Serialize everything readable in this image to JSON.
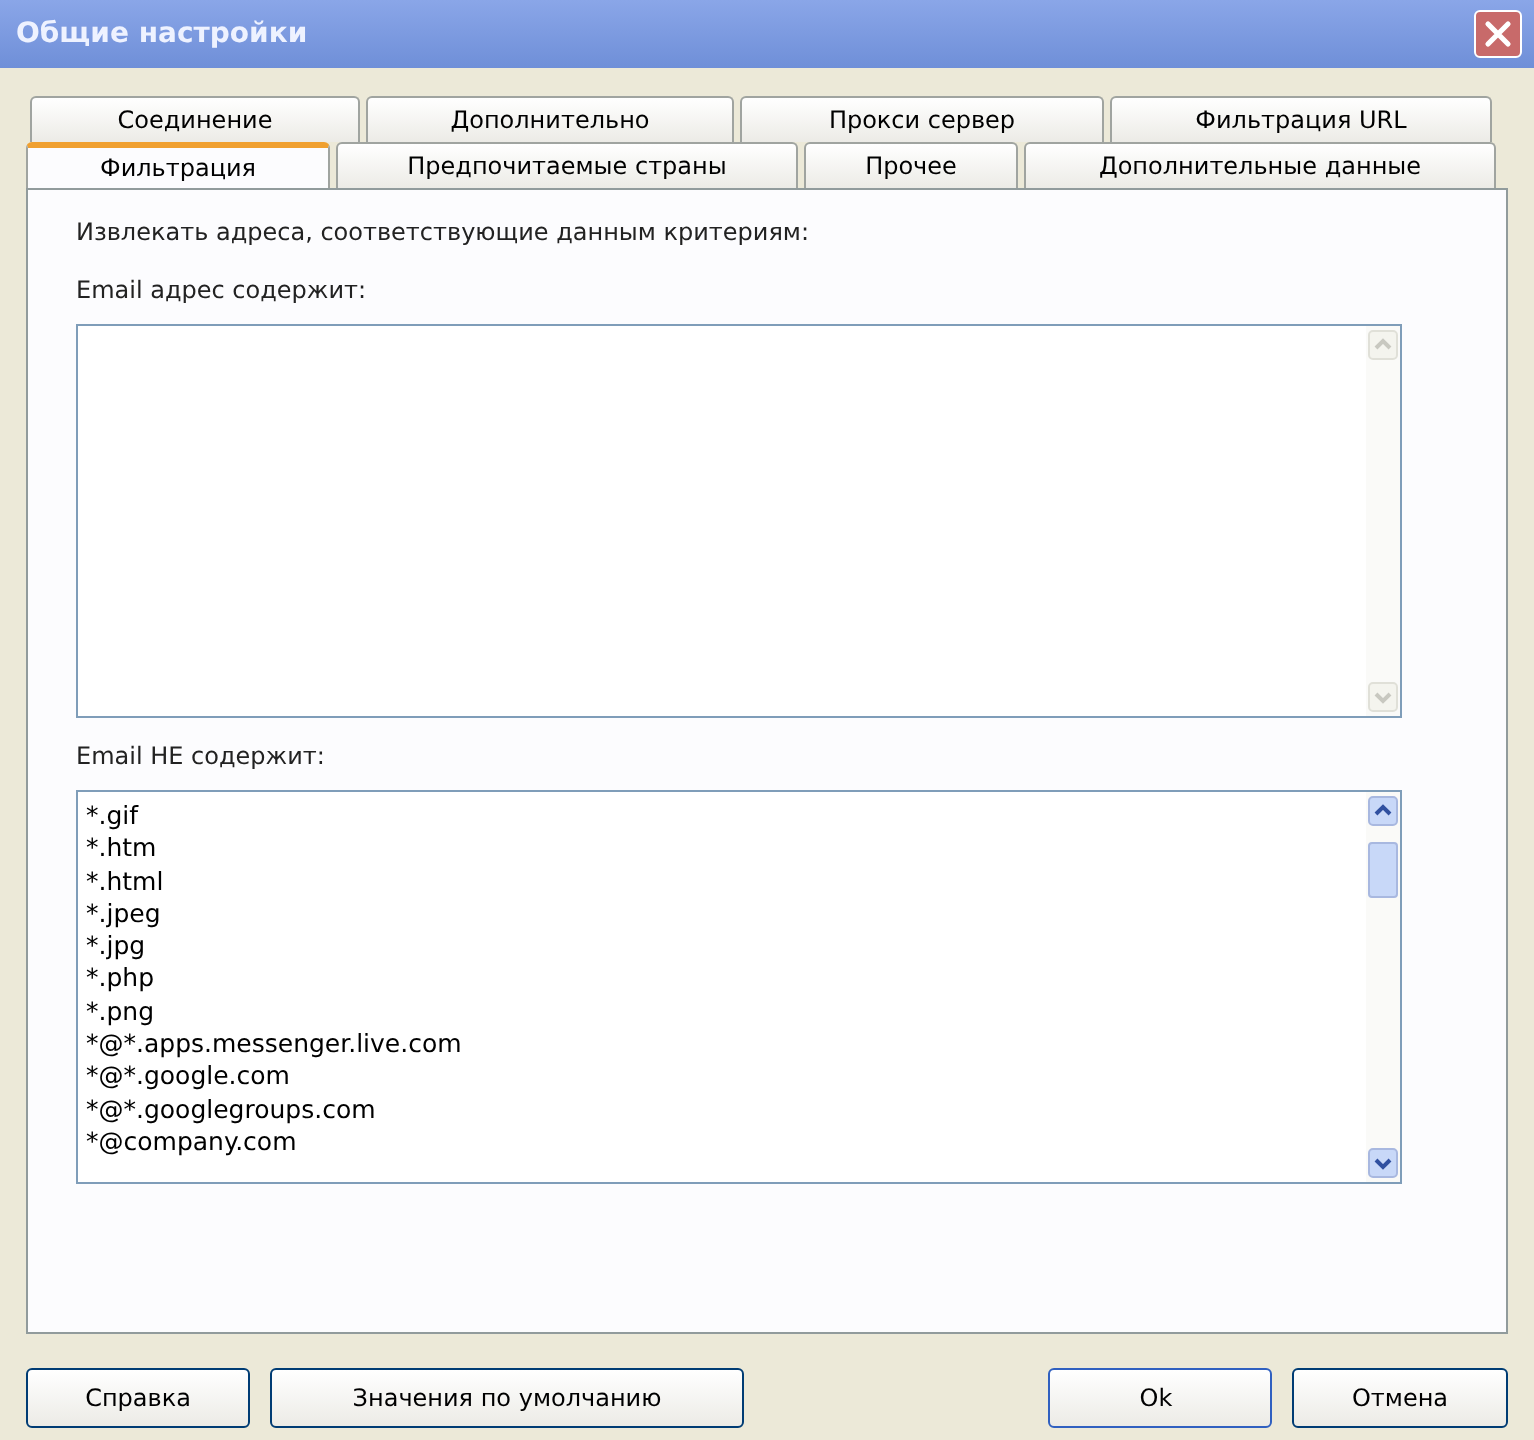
{
  "window": {
    "title": "Общие настройки"
  },
  "tab_rows": [
    [
      {
        "label": "Соединение",
        "selected": false
      },
      {
        "label": "Дополнительно",
        "selected": false
      },
      {
        "label": "Прокси сервер",
        "selected": false
      },
      {
        "label": "Фильтрация URL",
        "selected": false
      }
    ],
    [
      {
        "label": "Фильтрация",
        "selected": true
      },
      {
        "label": "Предпочитаемые страны",
        "selected": false
      },
      {
        "label": "Прочее",
        "selected": false
      },
      {
        "label": "Дополнительные данные",
        "selected": false
      }
    ]
  ],
  "intro": "Извлекать адреса, соответствующие данным критериям:",
  "include": {
    "label": "Email адрес содержит:",
    "disabled_scroll": true
  },
  "exclude": {
    "label": "Email НЕ содержит:",
    "lines": [
      "*.gif",
      "*.htm",
      "*.html",
      "*.jpeg",
      "*.jpg",
      "*.php",
      "*.png",
      "*@*.apps.messenger.live.com",
      "*@*.google.com",
      "*@*.googlegroups.com",
      "*@company.com"
    ],
    "disabled_scroll": false
  },
  "buttons_left": [
    "Справка",
    "Значения по умолчанию"
  ],
  "buttons_right": [
    "Ok",
    "Отмена"
  ]
}
